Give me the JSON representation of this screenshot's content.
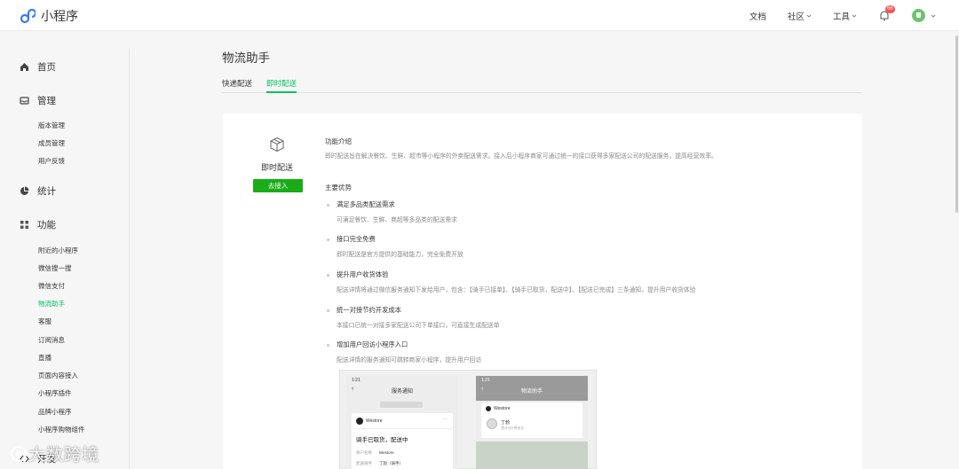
{
  "app": {
    "title": "小程序"
  },
  "topnav": {
    "docs": "文档",
    "community": "社区",
    "tools": "工具",
    "notification_count": "66"
  },
  "sidebar": {
    "home": "首页",
    "manage": "管理",
    "manage_items": [
      "版本管理",
      "成员管理",
      "用户反馈"
    ],
    "stats": "统计",
    "features": "功能",
    "feature_items": [
      "附近的小程序",
      "微信搜一搜",
      "微信支付",
      "物流助手",
      "客服",
      "订阅消息",
      "直播",
      "页面内容接入",
      "小程序插件",
      "品牌小程序",
      "小程序购物组件"
    ],
    "active_item": "物流助手",
    "dev": "开发"
  },
  "main": {
    "title": "物流助手",
    "tabs": [
      "快递配送",
      "即时配送"
    ],
    "active_tab": "即时配送"
  },
  "card": {
    "feature_name": "即时配送",
    "button": "去接入",
    "intro_title": "功能介绍",
    "intro_text": "即时配送旨在解决餐饮、生鲜、超市等小程序的外卖配送需求。接入后小程序商家可通过统一的接口获得多家配送公司的配送服务，提高经营效率。",
    "advantages_title": "主要优势",
    "advantages": [
      {
        "title": "满足多品类配送需求",
        "desc": "可满足餐饮、生鲜、商超等多品类的配送需求"
      },
      {
        "title": "接口完全免费",
        "desc": "即时配送是官方提供的基础能力，完全免费开放"
      },
      {
        "title": "提升用户收货体验",
        "desc": "配送详情将通过微信服务通知下发给用户，包含：【骑手已接单】、【骑手已取货，配送中】、【配送已完成】三条通知，提升用户收货体验"
      },
      {
        "title": "统一对接节约开发成本",
        "desc": "本接口已统一对接多家配送公司下单接口，可直接生成配送单"
      },
      {
        "title": "增加用户回访小程序入口",
        "desc": "配送详情的服务通知可跳转商家小程序，提升用户回访"
      }
    ]
  },
  "preview": {
    "phone1": {
      "time": "1:21",
      "title": "服务通知",
      "brand": "Westore",
      "status": "骑手已取货，配送中",
      "kv": [
        {
          "k": "商户名称",
          "v": "Westore"
        },
        {
          "k": "配送骑手",
          "v": "丁勃（骑手）"
        }
      ]
    },
    "phone2": {
      "time": "1:21",
      "title": "物流助手",
      "brand": "Westore",
      "rider": "丁勃",
      "rider_sub": "预计5分钟送达"
    }
  },
  "watermark": "大数跨境"
}
